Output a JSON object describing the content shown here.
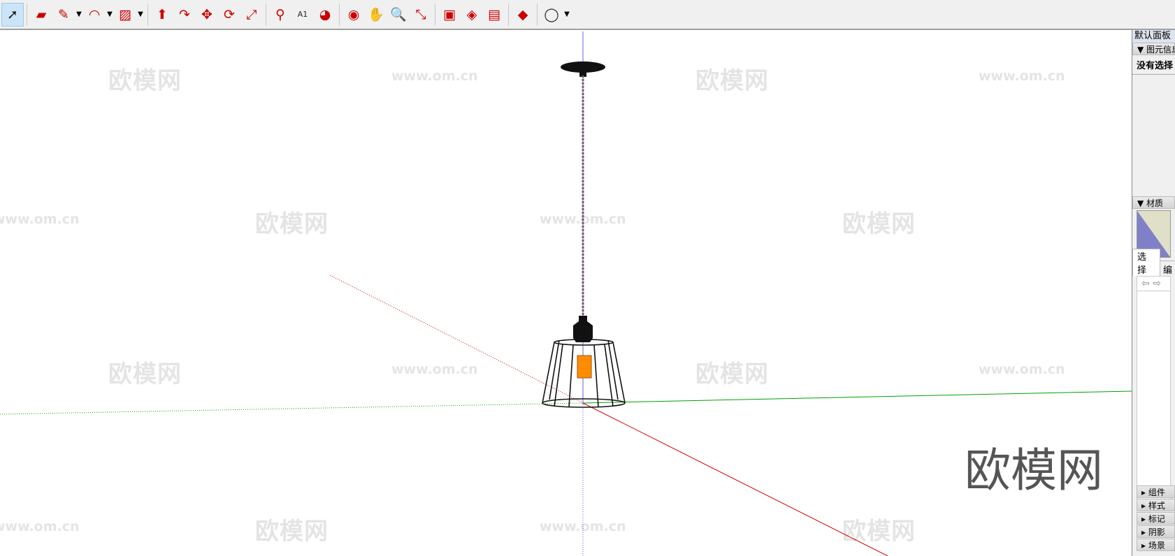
{
  "toolbar": {
    "tools": [
      {
        "name": "select",
        "glyph": "➚",
        "selected": true
      },
      {
        "name": "eraser",
        "glyph": "▰"
      },
      {
        "name": "pencil",
        "glyph": "✎",
        "dropdown": true
      },
      {
        "name": "arc",
        "glyph": "◠",
        "dropdown": true
      },
      {
        "name": "rectangle",
        "glyph": "▨",
        "dropdown": true
      },
      {
        "name": "push-pull",
        "glyph": "⬆"
      },
      {
        "name": "follow-me",
        "glyph": "↷"
      },
      {
        "name": "move",
        "glyph": "✥"
      },
      {
        "name": "rotate",
        "glyph": "⟳"
      },
      {
        "name": "scale",
        "glyph": "⤢"
      },
      {
        "name": "tape-measure",
        "glyph": "⚲"
      },
      {
        "name": "text",
        "glyph": "A1"
      },
      {
        "name": "paint-bucket",
        "glyph": "◕"
      },
      {
        "name": "orbit",
        "glyph": "◉"
      },
      {
        "name": "pan",
        "glyph": "✋"
      },
      {
        "name": "zoom",
        "glyph": "🔍"
      },
      {
        "name": "zoom-extents",
        "glyph": "⤡"
      },
      {
        "name": "3d-warehouse",
        "glyph": "▣"
      },
      {
        "name": "extension-warehouse",
        "glyph": "◈"
      },
      {
        "name": "send-to-layout",
        "glyph": "▤"
      },
      {
        "name": "ruby-console",
        "glyph": "◆"
      },
      {
        "name": "account",
        "glyph": "◯",
        "dropdown": true
      }
    ]
  },
  "watermark": {
    "cn": "欧模网",
    "url": "www.om.cn"
  },
  "panel": {
    "title": "默认面板",
    "entity_info": "图元信息",
    "no_selection": "没有选择",
    "materials": "材质",
    "tab_select": "选择",
    "tab_edit": "编",
    "collapsed": [
      "组件",
      "样式",
      "标记",
      "阴影",
      "场景"
    ]
  },
  "colors": {
    "red_axis": "#d00000",
    "green_axis": "#00a000",
    "blue_axis": "#3030d0",
    "bulb": "#ff8c00"
  }
}
